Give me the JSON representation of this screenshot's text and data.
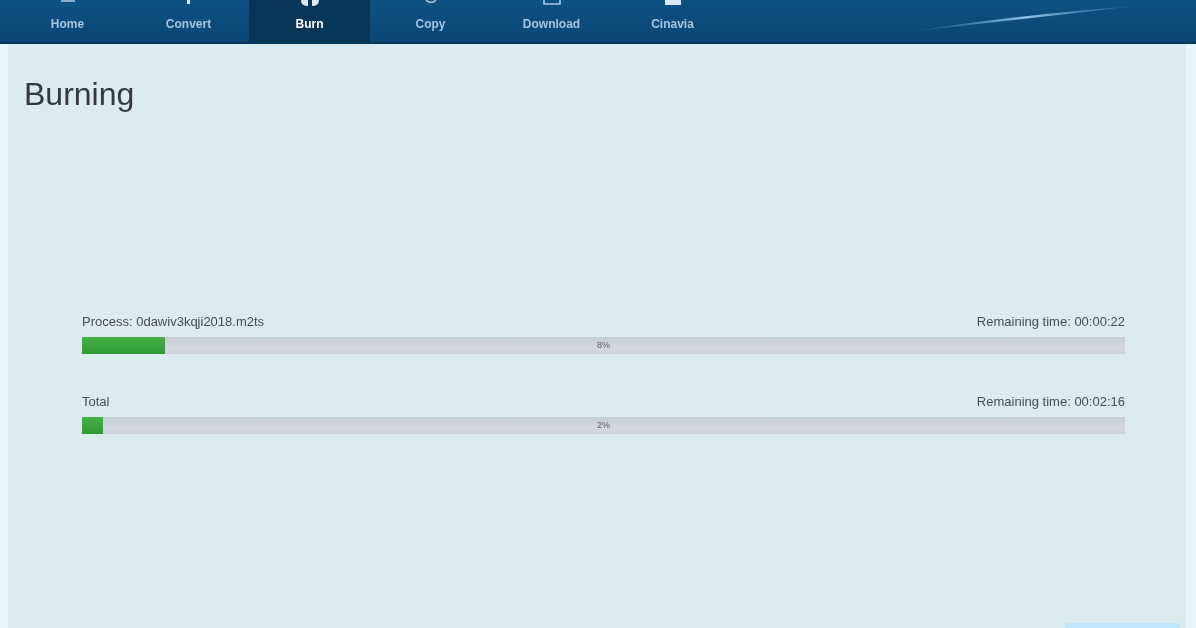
{
  "nav": {
    "tabs": [
      {
        "label": "Home",
        "selected": false
      },
      {
        "label": "Convert",
        "selected": false
      },
      {
        "label": "Burn",
        "selected": true
      },
      {
        "label": "Copy",
        "selected": false
      },
      {
        "label": "Download",
        "selected": false
      },
      {
        "label": "Cinavia",
        "selected": false
      }
    ]
  },
  "page": {
    "title": "Burning"
  },
  "progress": [
    {
      "label": "Process: 0dawiv3kqji2018.m2ts",
      "remaining": "Remaining time: 00:00:22",
      "level": 0.08,
      "percent": "8%"
    },
    {
      "label": "Total",
      "remaining": "Remaining time: 00:02:16",
      "level": 0.02,
      "percent": "2%"
    }
  ]
}
